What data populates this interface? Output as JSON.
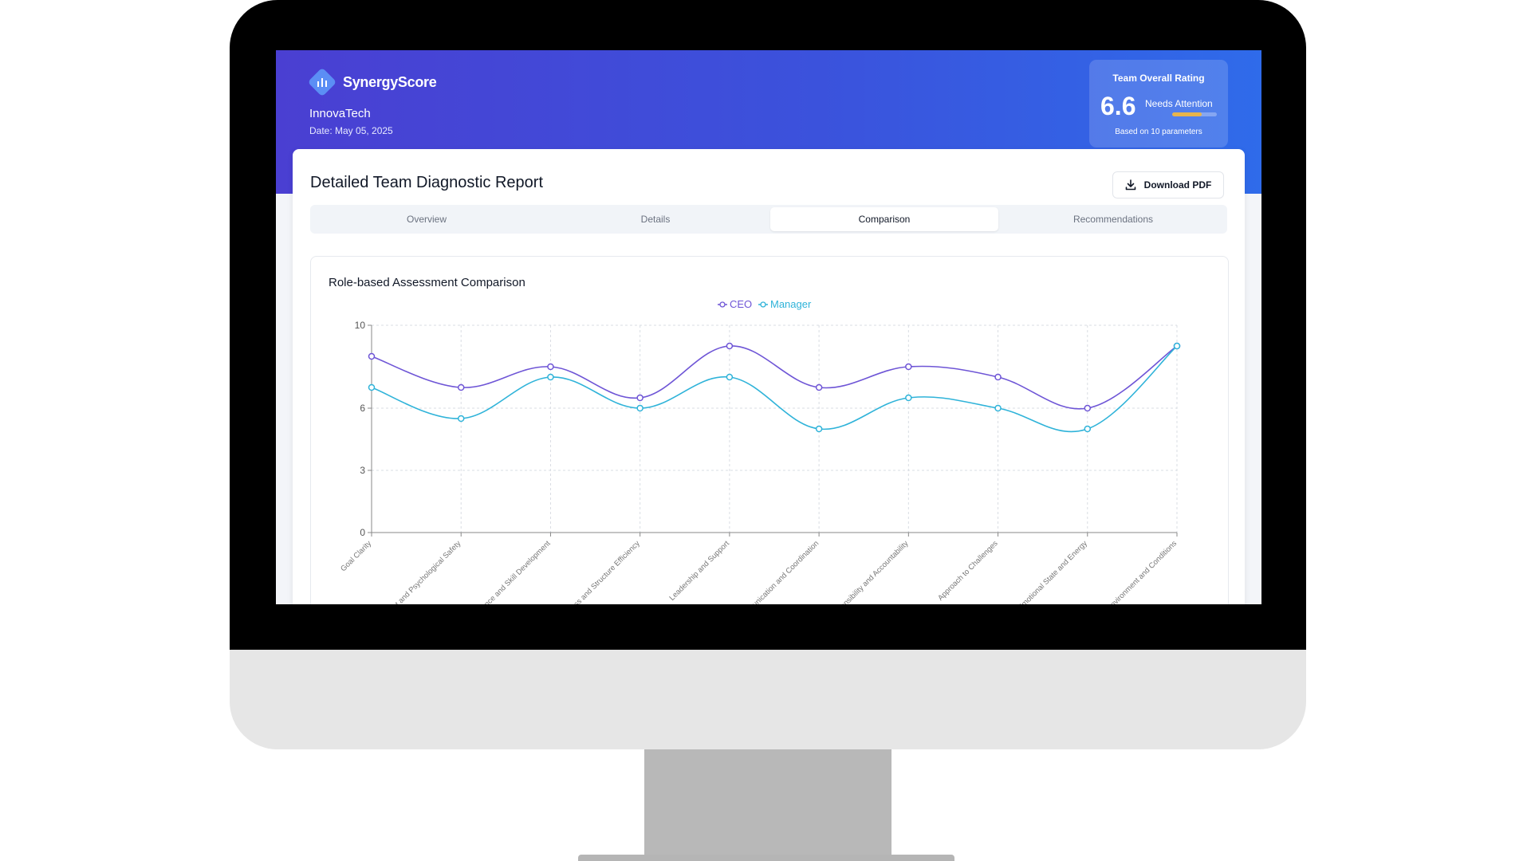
{
  "app": {
    "brand": "SynergyScore",
    "company": "InnovaTech",
    "date": "Date: May 05, 2025"
  },
  "rating": {
    "title": "Team Overall Rating",
    "value": "6.6",
    "status": "Needs Attention",
    "progress": 0.66,
    "note": "Based on 10 parameters",
    "bar_color": "#e8b44b"
  },
  "report": {
    "title": "Detailed Team Diagnostic Report",
    "download_label": "Download PDF"
  },
  "tabs": [
    {
      "label": "Overview",
      "active": false
    },
    {
      "label": "Details",
      "active": false
    },
    {
      "label": "Comparison",
      "active": true
    },
    {
      "label": "Recommendations",
      "active": false
    }
  ],
  "icons": {
    "logo": "bar-chart-icon",
    "download": "download-icon"
  },
  "chart_data": {
    "type": "line",
    "title": "Role-based Assessment Comparison",
    "categories": [
      "Goal Clarity",
      "Trust and Psychological Safety",
      "Competence and Skill Development",
      "Process and Structure Efficiency",
      "Leadership and Support",
      "Communication and Coordination",
      "Responsibility and Accountability",
      "Approach to Challenges",
      "Emotional State and Energy",
      "Work Environment and Conditions"
    ],
    "series": [
      {
        "name": "CEO",
        "color": "#6e55d6",
        "values": [
          8.5,
          7,
          8,
          6.5,
          9,
          7,
          8,
          7.5,
          6,
          9
        ]
      },
      {
        "name": "Manager",
        "color": "#2fb3d9",
        "values": [
          7,
          5.5,
          7.5,
          6,
          7.5,
          5,
          6.5,
          6,
          5,
          9
        ]
      }
    ],
    "ylim": [
      0,
      10
    ],
    "yticks": [
      "0",
      "3",
      "6",
      "10"
    ],
    "grid": true,
    "legend": "top-center"
  }
}
